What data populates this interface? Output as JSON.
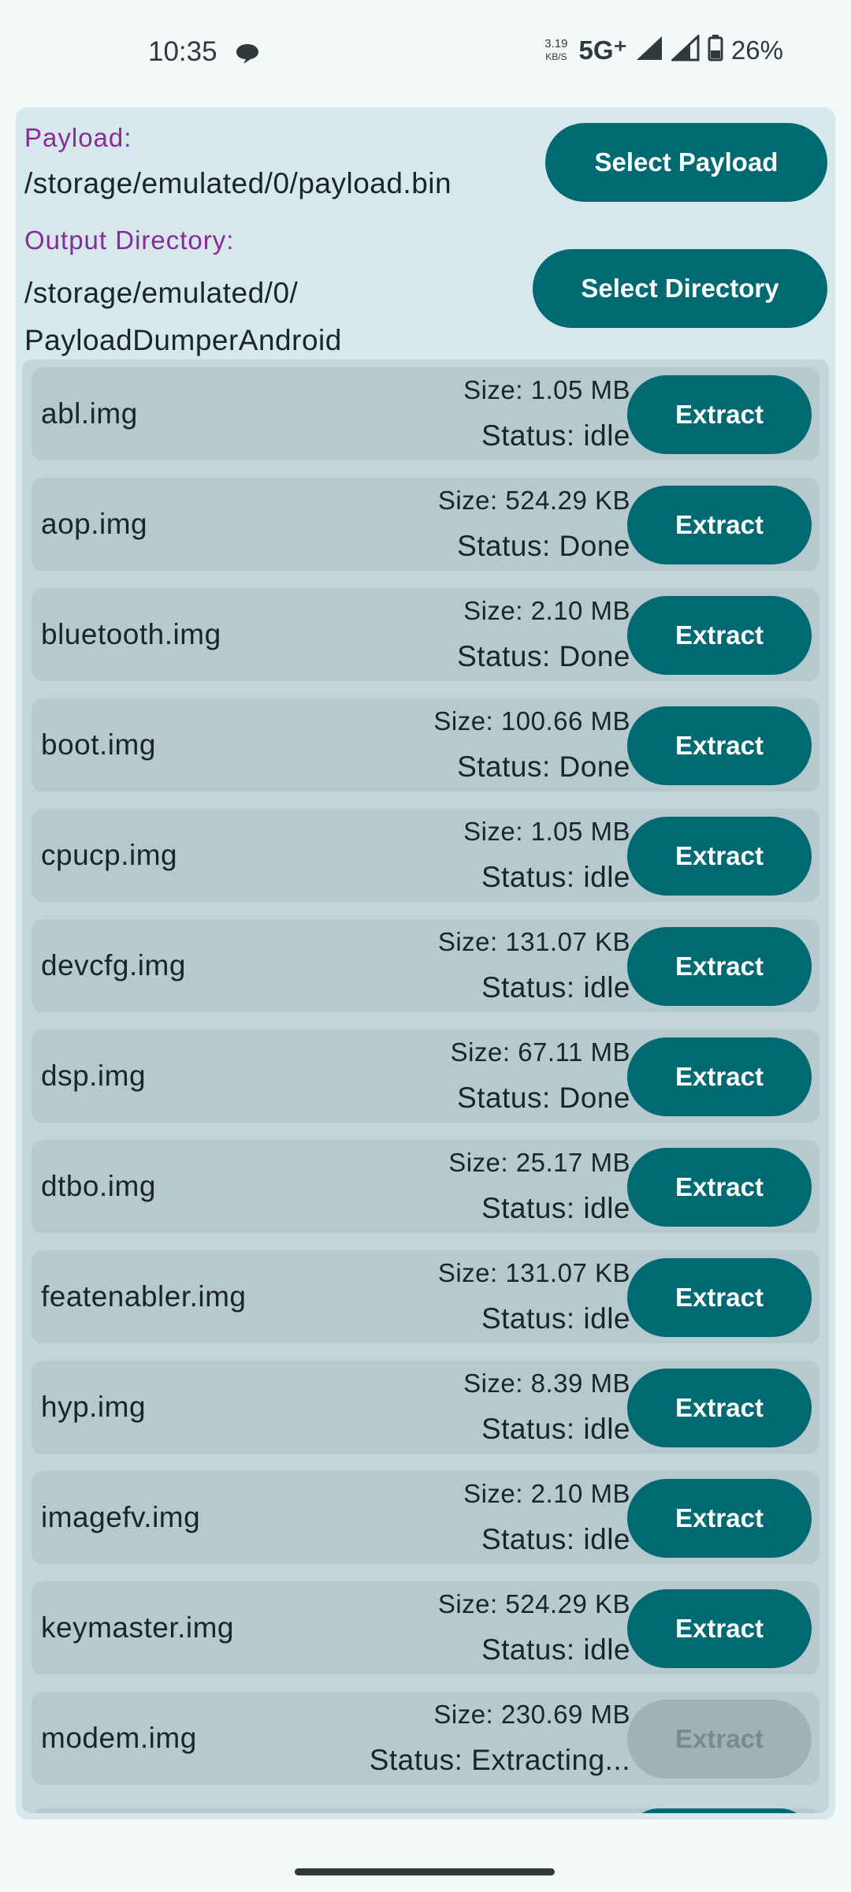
{
  "status_bar": {
    "time": "10:35",
    "net_speed_value": "3.19",
    "net_speed_unit": "KB/S",
    "network_type": "5G⁺",
    "battery_percent": "26%"
  },
  "header": {
    "payload_label": "Payload:",
    "payload_path": "/storage/emulated/0/payload.bin",
    "payload_button": "Select Payload",
    "output_label": "Output Directory:",
    "output_path": "/storage/emulated/0/\nPayloadDumperAndroid",
    "output_button": "Select Directory"
  },
  "partitions": [
    {
      "name": "abl.img",
      "size": "Size: 1.05 MB",
      "status": "Status: idle",
      "button": "Extract",
      "enabled": true
    },
    {
      "name": "aop.img",
      "size": "Size: 524.29 KB",
      "status": "Status: Done",
      "button": "Extract",
      "enabled": true
    },
    {
      "name": "bluetooth.img",
      "size": "Size: 2.10 MB",
      "status": "Status: Done",
      "button": "Extract",
      "enabled": true
    },
    {
      "name": "boot.img",
      "size": "Size: 100.66 MB",
      "status": "Status: Done",
      "button": "Extract",
      "enabled": true
    },
    {
      "name": "cpucp.img",
      "size": "Size: 1.05 MB",
      "status": "Status: idle",
      "button": "Extract",
      "enabled": true
    },
    {
      "name": "devcfg.img",
      "size": "Size: 131.07 KB",
      "status": "Status: idle",
      "button": "Extract",
      "enabled": true
    },
    {
      "name": "dsp.img",
      "size": "Size: 67.11 MB",
      "status": "Status: Done",
      "button": "Extract",
      "enabled": true
    },
    {
      "name": "dtbo.img",
      "size": "Size: 25.17 MB",
      "status": "Status: idle",
      "button": "Extract",
      "enabled": true
    },
    {
      "name": "featenabler.img",
      "size": "Size: 131.07 KB",
      "status": "Status: idle",
      "button": "Extract",
      "enabled": true
    },
    {
      "name": "hyp.img",
      "size": "Size: 8.39 MB",
      "status": "Status: idle",
      "button": "Extract",
      "enabled": true
    },
    {
      "name": "imagefv.img",
      "size": "Size: 2.10 MB",
      "status": "Status: idle",
      "button": "Extract",
      "enabled": true
    },
    {
      "name": "keymaster.img",
      "size": "Size: 524.29 KB",
      "status": "Status: idle",
      "button": "Extract",
      "enabled": true
    },
    {
      "name": "modem.img",
      "size": "Size: 230.69 MB",
      "status": "Status: Extracting...",
      "button": "Extract",
      "enabled": false
    }
  ],
  "colors": {
    "accent": "#006a72",
    "label": "#8a2a98",
    "panel": "#d6e8eb",
    "row": "#b6c9cf"
  }
}
